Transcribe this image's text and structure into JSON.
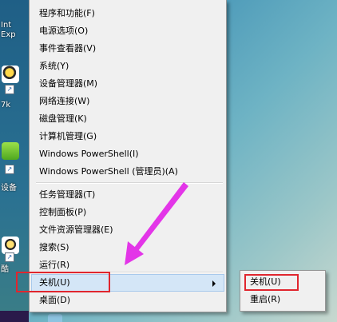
{
  "desktop": {
    "icon_texts": [
      "Int",
      "Exp",
      "7k",
      "酷",
      "设备"
    ]
  },
  "menu": {
    "groups": [
      [
        "程序和功能(F)",
        "电源选项(O)",
        "事件查看器(V)",
        "系统(Y)",
        "设备管理器(M)",
        "网络连接(W)",
        "磁盘管理(K)",
        "计算机管理(G)",
        "Windows PowerShell(I)",
        "Windows PowerShell (管理员)(A)"
      ],
      [
        "任务管理器(T)",
        "控制面板(P)",
        "文件资源管理器(E)",
        "搜索(S)",
        "运行(R)"
      ],
      [
        "关机(U)",
        "桌面(D)"
      ]
    ]
  },
  "submenu": {
    "items": [
      "关机(U)",
      "重启(R)"
    ]
  },
  "colors": {
    "annotation_red": "#e0262e",
    "annotation_arrow": "#e335e8",
    "highlight_bg": "#d4e6f7"
  }
}
